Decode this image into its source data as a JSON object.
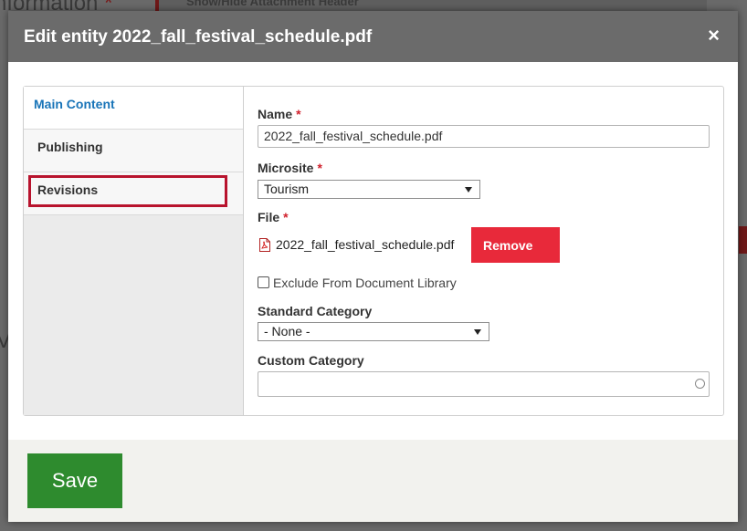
{
  "background": {
    "heading_fragment": "nformation",
    "heading_star": "*",
    "header_fragment": "Show/Hide Attachment Header",
    "letter_1": "i",
    "letter_2": "V"
  },
  "modal": {
    "title": "Edit entity 2022_fall_festival_schedule.pdf",
    "close_glyph": "×",
    "header_color": "#6b6b6b"
  },
  "tabs": [
    {
      "label": "Main Content",
      "active": true
    },
    {
      "label": "Publishing",
      "active": false
    },
    {
      "label": "Revisions",
      "active": false
    }
  ],
  "form": {
    "name_label": "Name",
    "name_value": "2022_fall_festival_schedule.pdf",
    "microsite_label": "Microsite",
    "microsite_value": "Tourism",
    "file_label": "File",
    "file_name": "2022_fall_festival_schedule.pdf",
    "file_icon": "pdf-icon",
    "remove_label": "Remove",
    "exclude_label": "Exclude From Document Library",
    "exclude_checked": false,
    "standard_category_label": "Standard Category",
    "standard_category_value": "- None -",
    "custom_category_label": "Custom Category",
    "custom_category_value": "",
    "required_mark": "*"
  },
  "footer": {
    "save_label": "Save",
    "save_color": "#2e8b2e"
  },
  "colors": {
    "accent_blue": "#1874b8",
    "remove_red": "#e8293a",
    "highlight_red": "#b8132d"
  }
}
